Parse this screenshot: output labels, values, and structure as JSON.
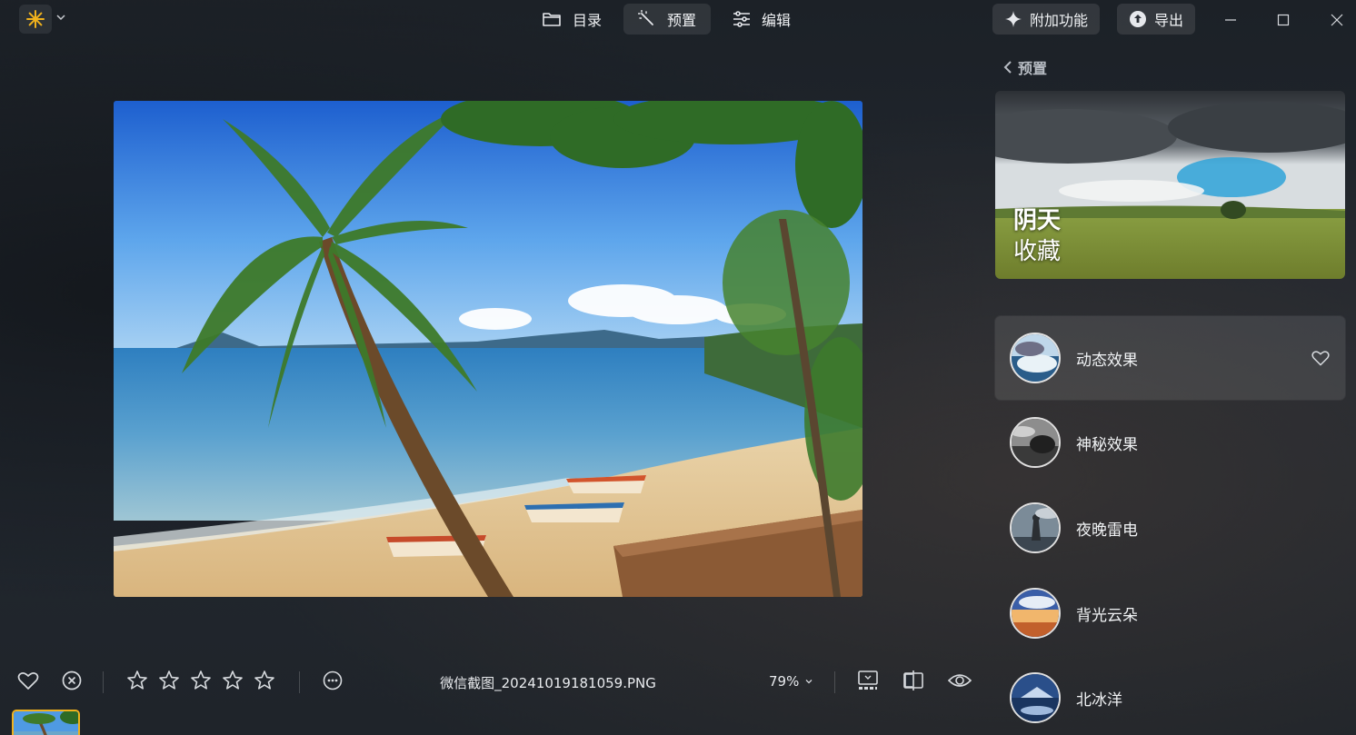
{
  "app": {
    "logo_icon": "sun-star-icon",
    "accent": "#f0b21d"
  },
  "tabs": [
    {
      "label": "目录",
      "icon": "folder-icon",
      "active": false
    },
    {
      "label": "预置",
      "icon": "magic-wand-icon",
      "active": true
    },
    {
      "label": "编辑",
      "icon": "sliders-icon",
      "active": false
    }
  ],
  "toolbar_right": {
    "addons_label": "附加功能",
    "export_label": "导出"
  },
  "bottom": {
    "filename": "微信截图_20241019181059.PNG",
    "zoom": "79%",
    "rating": 0
  },
  "panel": {
    "back_label": "预置",
    "hero": {
      "line1": "阴天",
      "line2": "收藏"
    },
    "presets": [
      {
        "label": "动态效果",
        "selected": true
      },
      {
        "label": "神秘效果",
        "selected": false
      },
      {
        "label": "夜晚雷电",
        "selected": false
      },
      {
        "label": "背光云朵",
        "selected": false
      },
      {
        "label": "北冰洋",
        "selected": false
      }
    ]
  }
}
